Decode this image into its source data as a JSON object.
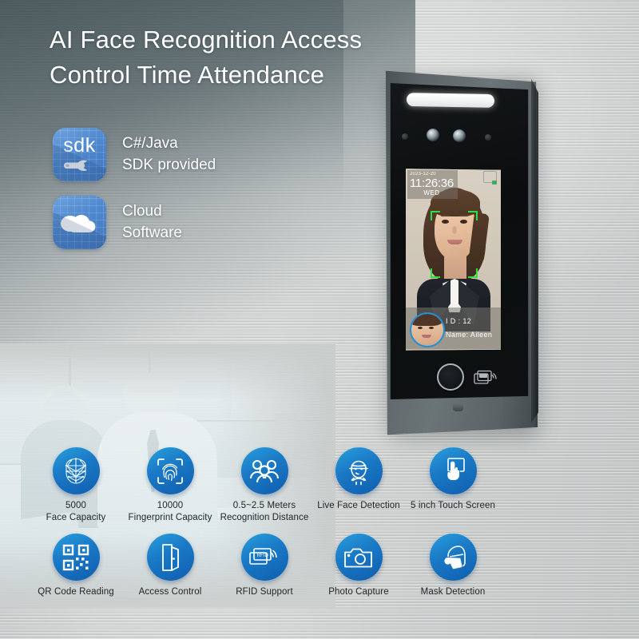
{
  "headline": {
    "line1": "AI Face Recognition Access",
    "line2": "Control Time Attendance"
  },
  "software": [
    {
      "icon": "sdk-icon",
      "tile_text": "sdk",
      "line1": "C#/Java",
      "line2": "SDK provided"
    },
    {
      "icon": "cloud-icon",
      "tile_text": "",
      "line1": "Cloud",
      "line2": "Software"
    }
  ],
  "device": {
    "screen": {
      "date": "2023-12-20",
      "time": "11:26:36",
      "weekday": "WED",
      "id_label": "I D :  12",
      "name_label": "Name:  Aileen"
    },
    "card_icon_text": "CARD"
  },
  "features": {
    "row1": [
      {
        "icon": "face-mesh-icon",
        "line1": "5000",
        "line2": "Face Capacity"
      },
      {
        "icon": "fingerprint-icon",
        "line1": "10000",
        "line2": "Fingerprint Capacity"
      },
      {
        "icon": "group-people-icon",
        "line1": "0.5~2.5 Meters",
        "line2": "Recognition Distance"
      },
      {
        "icon": "live-face-icon",
        "line1": "Live Face Detection",
        "line2": ""
      },
      {
        "icon": "touch-screen-icon",
        "line1": "5 inch Touch Screen",
        "line2": ""
      }
    ],
    "row2": [
      {
        "icon": "qr-code-icon",
        "line1": "QR Code Reading",
        "line2": ""
      },
      {
        "icon": "door-icon",
        "line1": "Access Control",
        "line2": ""
      },
      {
        "icon": "rfid-card-icon",
        "line1": "RFID Support",
        "line2": ""
      },
      {
        "icon": "camera-icon",
        "line1": "Photo Capture",
        "line2": ""
      },
      {
        "icon": "mask-face-icon",
        "line1": "Mask Detection",
        "line2": ""
      }
    ]
  },
  "colors": {
    "accent_blue": "#1a79c6",
    "accent_blue_dark": "#0f5fae",
    "tile_blue": "#4f88cf",
    "tracking_green": "#2fe03c",
    "wall_gray": "#c9cbca"
  }
}
